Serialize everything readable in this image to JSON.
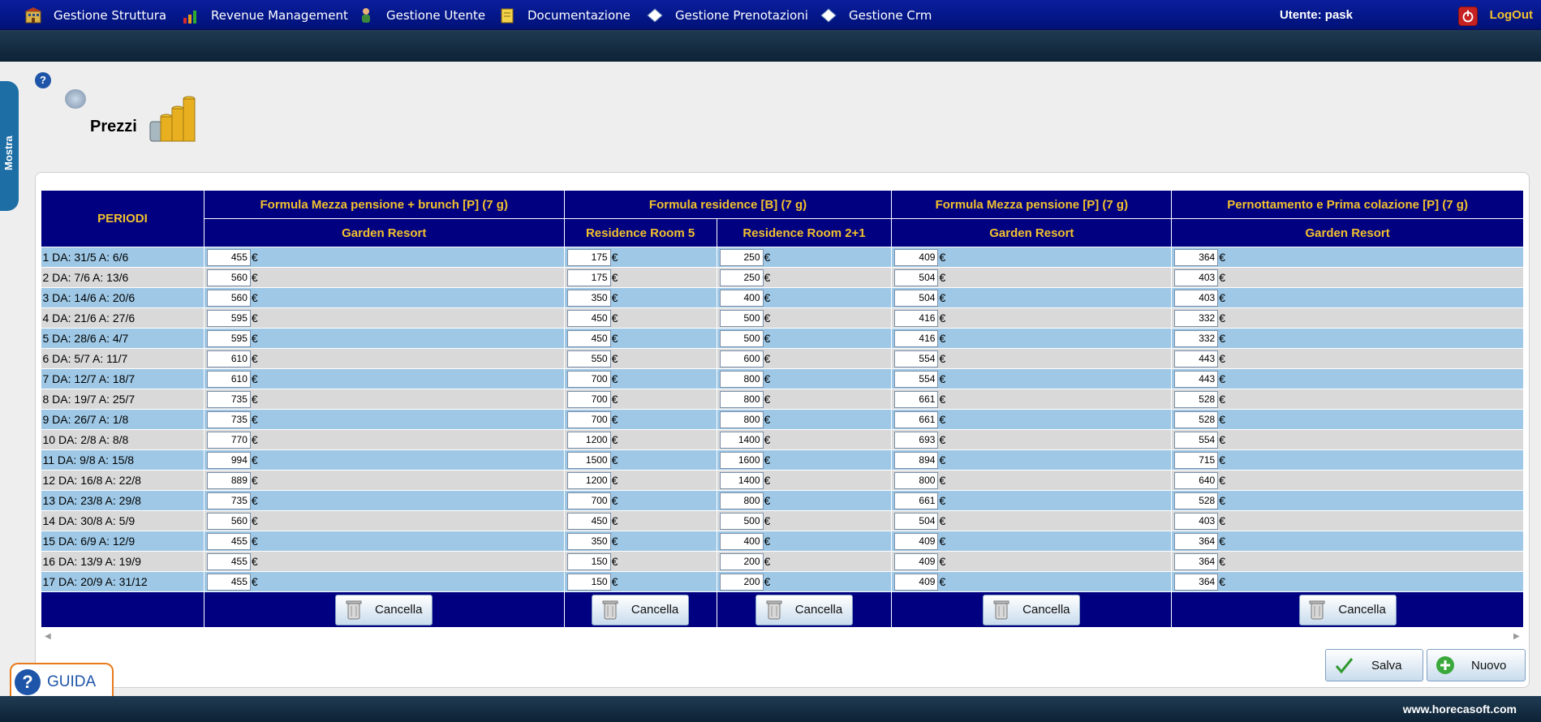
{
  "nav": {
    "items": [
      {
        "label": "Gestione Struttura",
        "icon": "building-icon"
      },
      {
        "label": "Revenue Management",
        "icon": "bar-chart-icon"
      },
      {
        "label": "Gestione Utente",
        "icon": "user-icon"
      },
      {
        "label": "Documentazione",
        "icon": "document-icon"
      },
      {
        "label": "Gestione Prenotazioni",
        "icon": "diamond-icon"
      },
      {
        "label": "Gestione Crm",
        "icon": "diamond-icon"
      }
    ],
    "user": "Utente: pask",
    "logout": "LogOut"
  },
  "side_tab": "Mostra",
  "page": {
    "title": "Prezzi"
  },
  "table": {
    "periodi_header": "PERIODI",
    "groups": [
      "Formula Mezza pensione + brunch [P] (7 g)",
      "Formula residence [B] (7 g)",
      "Formula Mezza pensione [P] (7 g)",
      "Pernottamento e Prima colazione [P] (7 g)"
    ],
    "rooms": [
      "Garden Resort",
      "Residence Room 5",
      "Residence Room 2+1",
      "Garden Resort",
      "Garden Resort"
    ],
    "currency": "€",
    "rows": [
      {
        "period": "1 DA: 31/5 A: 6/6",
        "prices": [
          "455",
          "175",
          "250",
          "409",
          "364"
        ]
      },
      {
        "period": "2 DA: 7/6 A: 13/6",
        "prices": [
          "560",
          "175",
          "250",
          "504",
          "403"
        ]
      },
      {
        "period": "3 DA: 14/6 A: 20/6",
        "prices": [
          "560",
          "350",
          "400",
          "504",
          "403"
        ]
      },
      {
        "period": "4 DA: 21/6 A: 27/6",
        "prices": [
          "595",
          "450",
          "500",
          "416",
          "332"
        ]
      },
      {
        "period": "5 DA: 28/6 A: 4/7",
        "prices": [
          "595",
          "450",
          "500",
          "416",
          "332"
        ]
      },
      {
        "period": "6 DA: 5/7 A: 11/7",
        "prices": [
          "610",
          "550",
          "600",
          "554",
          "443"
        ]
      },
      {
        "period": "7 DA: 12/7 A: 18/7",
        "prices": [
          "610",
          "700",
          "800",
          "554",
          "443"
        ]
      },
      {
        "period": "8 DA: 19/7 A: 25/7",
        "prices": [
          "735",
          "700",
          "800",
          "661",
          "528"
        ]
      },
      {
        "period": "9 DA: 26/7 A: 1/8",
        "prices": [
          "735",
          "700",
          "800",
          "661",
          "528"
        ]
      },
      {
        "period": "10 DA: 2/8 A: 8/8",
        "prices": [
          "770",
          "1200",
          "1400",
          "693",
          "554"
        ]
      },
      {
        "period": "11 DA: 9/8 A: 15/8",
        "prices": [
          "994",
          "1500",
          "1600",
          "894",
          "715"
        ]
      },
      {
        "period": "12 DA: 16/8 A: 22/8",
        "prices": [
          "889",
          "1200",
          "1400",
          "800",
          "640"
        ]
      },
      {
        "period": "13 DA: 23/8 A: 29/8",
        "prices": [
          "735",
          "700",
          "800",
          "661",
          "528"
        ]
      },
      {
        "period": "14 DA: 30/8 A: 5/9",
        "prices": [
          "560",
          "450",
          "500",
          "504",
          "403"
        ]
      },
      {
        "period": "15 DA: 6/9 A: 12/9",
        "prices": [
          "455",
          "350",
          "400",
          "409",
          "364"
        ]
      },
      {
        "period": "16 DA: 13/9 A: 19/9",
        "prices": [
          "455",
          "150",
          "200",
          "409",
          "364"
        ]
      },
      {
        "period": "17 DA: 20/9 A: 31/12",
        "prices": [
          "455",
          "150",
          "200",
          "409",
          "364"
        ]
      }
    ],
    "delete_label": "Cancella"
  },
  "actions": {
    "save": "Salva",
    "new": "Nuovo"
  },
  "guida": "GUIDA",
  "footer": {
    "site": "www.horecasoft.com"
  }
}
